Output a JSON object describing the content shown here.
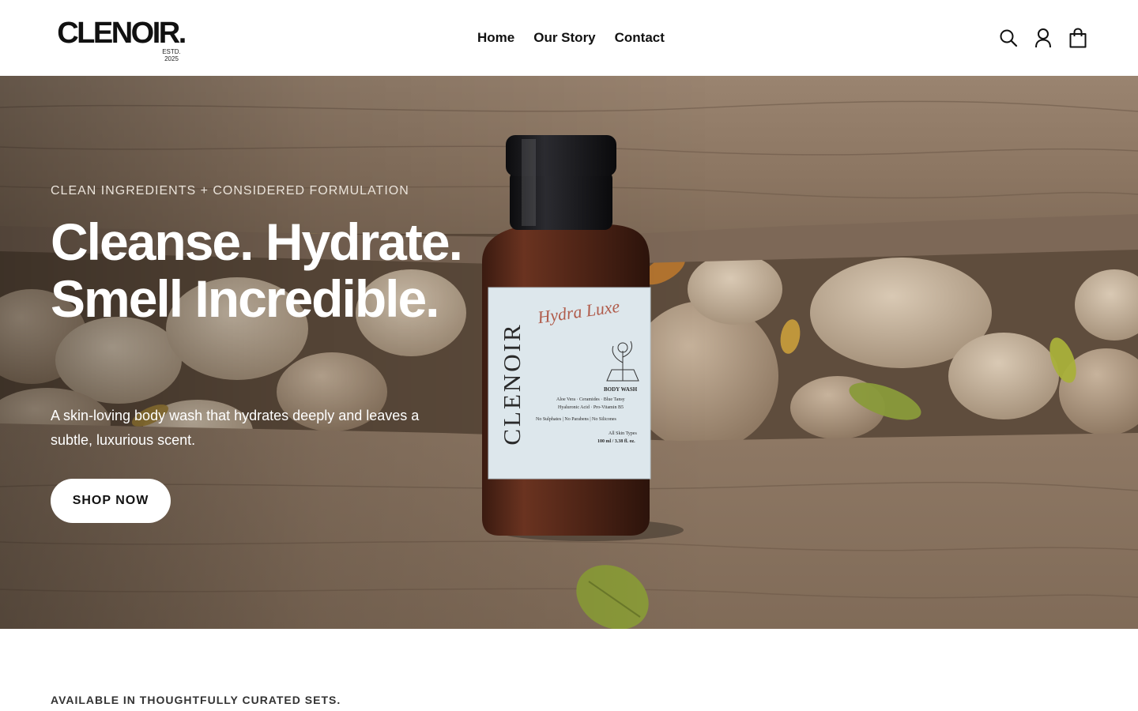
{
  "brand": {
    "logo_text": "CLENOIR.",
    "logo_sub": "ESTD. 2025"
  },
  "nav": {
    "items": [
      {
        "label": "Home"
      },
      {
        "label": "Our Story"
      },
      {
        "label": "Contact"
      }
    ]
  },
  "header_icons": [
    "search-icon",
    "account-icon",
    "cart-icon"
  ],
  "hero": {
    "eyebrow": "CLEAN INGREDIENTS + CONSIDERED FORMULATION",
    "headline": "Cleanse. Hydrate. Smell Incredible.",
    "subtext": "A skin-loving body wash that hydrates deeply and leaves a subtle, luxurious scent.",
    "cta_label": "SHOP NOW"
  },
  "product_label": {
    "brand": "CLENOIR",
    "name": "Hydra Luxe",
    "type": "BODY WASH",
    "ingredients_1": "Aloe Vera · Ceramides · Blue Tansy",
    "ingredients_2": "Hyaluronic Acid · Pro-Vitamin B5",
    "free_from": "No Sulphates | No Parabens | No Silicones",
    "skin": "All Skin Types",
    "volume": "100 ml / 3.38 fl. oz."
  },
  "section": {
    "curated_label": "AVAILABLE IN THOUGHTFULLY CURATED SETS."
  },
  "colors": {
    "wood": "#8a7563",
    "text_dark": "#111111",
    "label_blue": "#dde7ec"
  }
}
